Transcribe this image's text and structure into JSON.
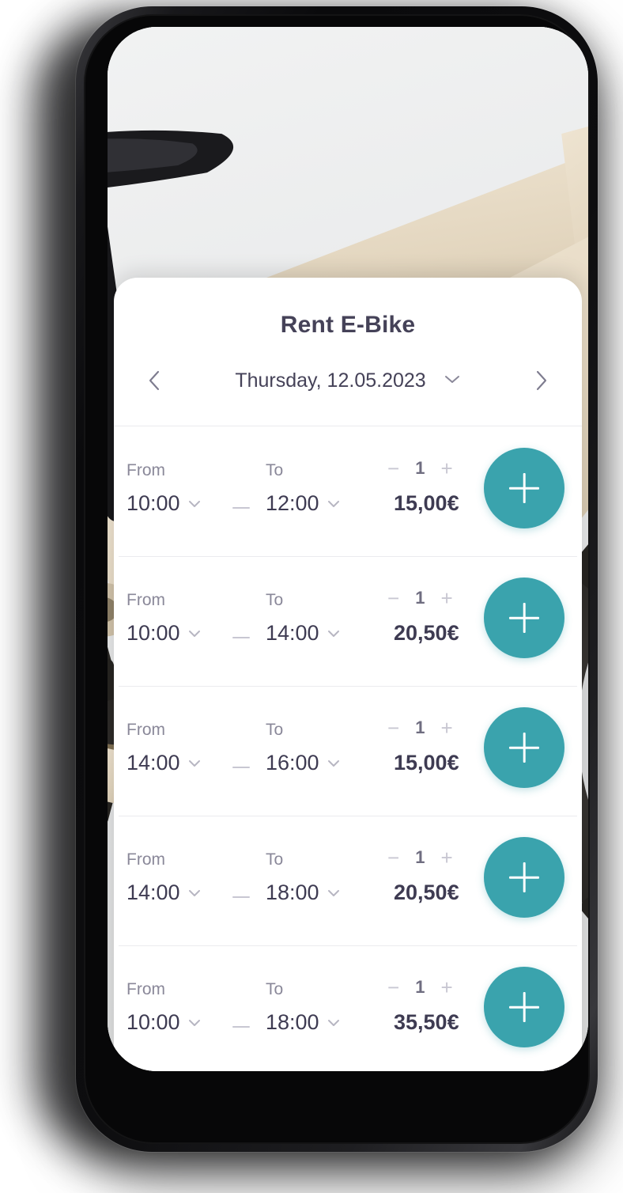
{
  "app": {
    "sheet_title": "Rent E-Bike"
  },
  "date_nav": {
    "prev_icon": "chevron-left-icon",
    "next_icon": "chevron-right-icon",
    "date_label": "Thursday, 12.05.2023",
    "dropdown_icon": "chevron-down-icon"
  },
  "row_labels": {
    "from": "From",
    "to": "To"
  },
  "stepper": {
    "minus": "−",
    "plus": "+"
  },
  "hero": {
    "alt": "e-bike-product-photo"
  },
  "colors": {
    "accent": "#3aa3ad",
    "text_dark": "#3e3b52",
    "title": "#454258",
    "muted": "#8a8899",
    "divider": "#ebebee"
  },
  "slots": [
    {
      "from_label": "From",
      "to_label": "To",
      "from_time": "10:00",
      "to_time": "12:00",
      "price": "15,00€",
      "quantity": "1",
      "add_label": "+"
    },
    {
      "from_label": "From",
      "to_label": "To",
      "from_time": "10:00",
      "to_time": "14:00",
      "price": "20,50€",
      "quantity": "1",
      "add_label": "+"
    },
    {
      "from_label": "From",
      "to_label": "To",
      "from_time": "14:00",
      "to_time": "16:00",
      "price": "15,00€",
      "quantity": "1",
      "add_label": "+"
    },
    {
      "from_label": "From",
      "to_label": "To",
      "from_time": "14:00",
      "to_time": "18:00",
      "price": "20,50€",
      "quantity": "1",
      "add_label": "+"
    },
    {
      "from_label": "From",
      "to_label": "To",
      "from_time": "10:00",
      "to_time": "18:00",
      "price": "35,50€",
      "quantity": "1",
      "add_label": "+"
    }
  ]
}
